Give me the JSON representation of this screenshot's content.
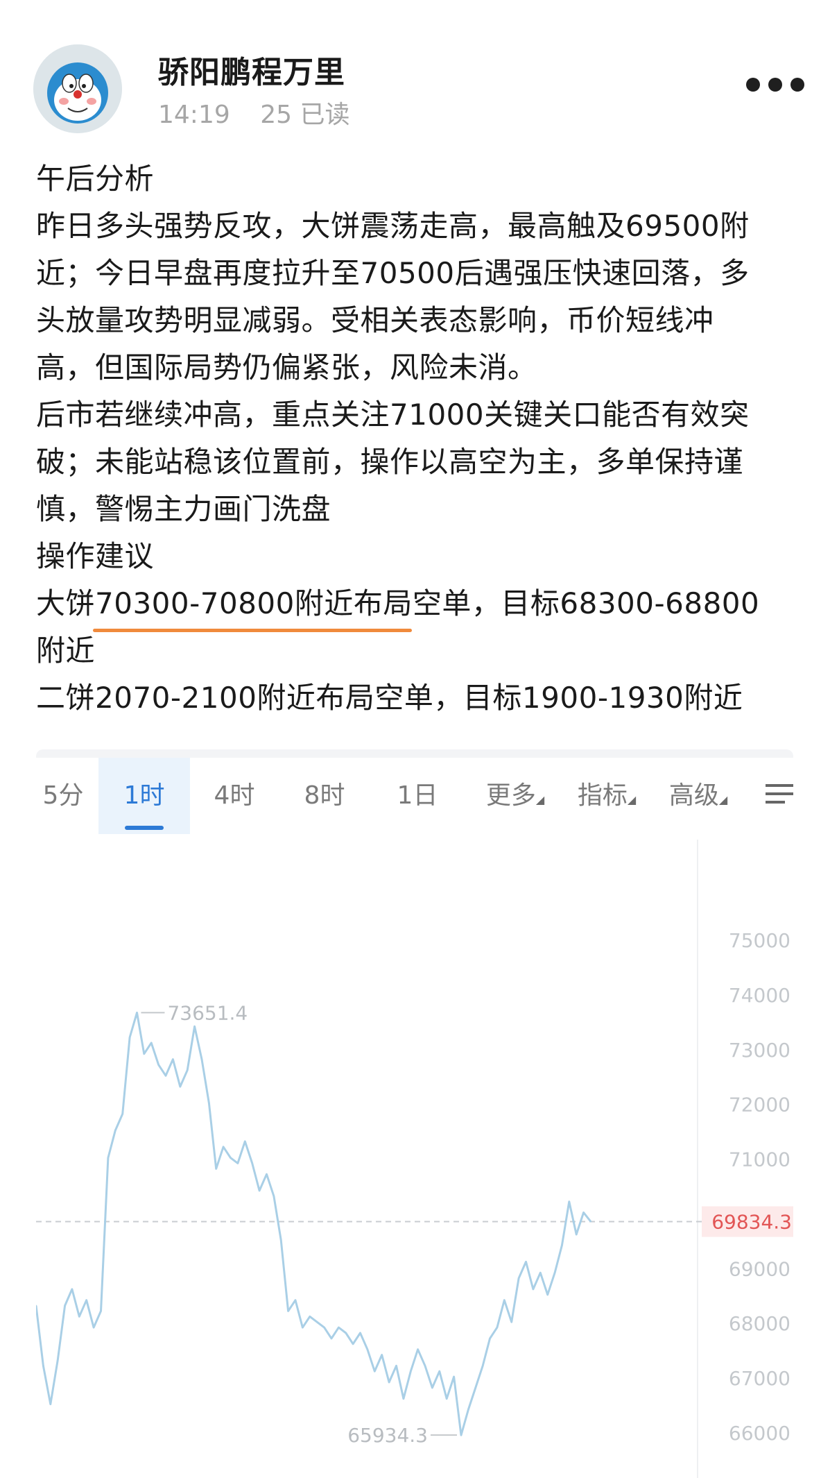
{
  "post": {
    "author": "骄阳鹏程万里",
    "time": "14:19",
    "reads": "25 已读",
    "avatar_icon": "doraemon-avatar",
    "more_icon": "more-dots-icon",
    "lines": [
      "午后分析",
      "昨日多头强势反攻，大饼震荡走高，最高触及69500附",
      "近；今日早盘再度拉升至70500后遇强压快速回落，多",
      "头放量攻势明显减弱。受相关表态影响，币价短线冲",
      "高，但国际局势仍偏紧张，风险未消。",
      "后市若继续冲高，重点关注71000关键关口能否有效突",
      "破；未能站稳该位置前，操作以高空为主，多单保持谨",
      "慎，警惕主力画门洗盘",
      "操作建议",
      "大饼70300-70800附近布局空单，目标68300-68800",
      "附近",
      "二饼2070-2100附近布局空单，目标1900-1930附近"
    ],
    "highlight_color": "#f08a3c"
  },
  "chart_toolbar": {
    "tabs": [
      "5分",
      "1时",
      "4时",
      "8时",
      "1日",
      "更多",
      "指标",
      "高级"
    ],
    "active_tab": "1时",
    "settings_icon": "chart-settings-icon",
    "accent": "#2d7ad6"
  },
  "chart_data": {
    "type": "line",
    "yticks": [
      "75000",
      "74000",
      "73000",
      "72000",
      "71000",
      "69000",
      "68000",
      "67000",
      "66000"
    ],
    "ylim": [
      65500,
      75500
    ],
    "y": [
      68300,
      67200,
      66500,
      67300,
      68300,
      68600,
      68100,
      68400,
      67900,
      68200,
      71000,
      71500,
      71800,
      73200,
      73651.4,
      72900,
      73100,
      72700,
      72500,
      72800,
      72300,
      72600,
      73400,
      72800,
      72000,
      70800,
      71200,
      71000,
      70900,
      71300,
      70900,
      70400,
      70700,
      70300,
      69500,
      68200,
      68400,
      67900,
      68100,
      68000,
      67900,
      67700,
      67900,
      67800,
      67600,
      67800,
      67500,
      67100,
      67400,
      66900,
      67200,
      66600,
      67100,
      67500,
      67200,
      66800,
      67100,
      66600,
      67000,
      65934.3,
      66400,
      66800,
      67200,
      67700,
      67900,
      68400,
      68000,
      68800,
      69100,
      68600,
      68900,
      68500,
      68900,
      69400,
      70200,
      69600,
      70000,
      69834.3
    ],
    "max_label": "73651.4",
    "min_label": "65934.3",
    "current_price": "69834.3",
    "line_color": "#a9cfe6",
    "price_color": "#e25555",
    "grid": false
  }
}
